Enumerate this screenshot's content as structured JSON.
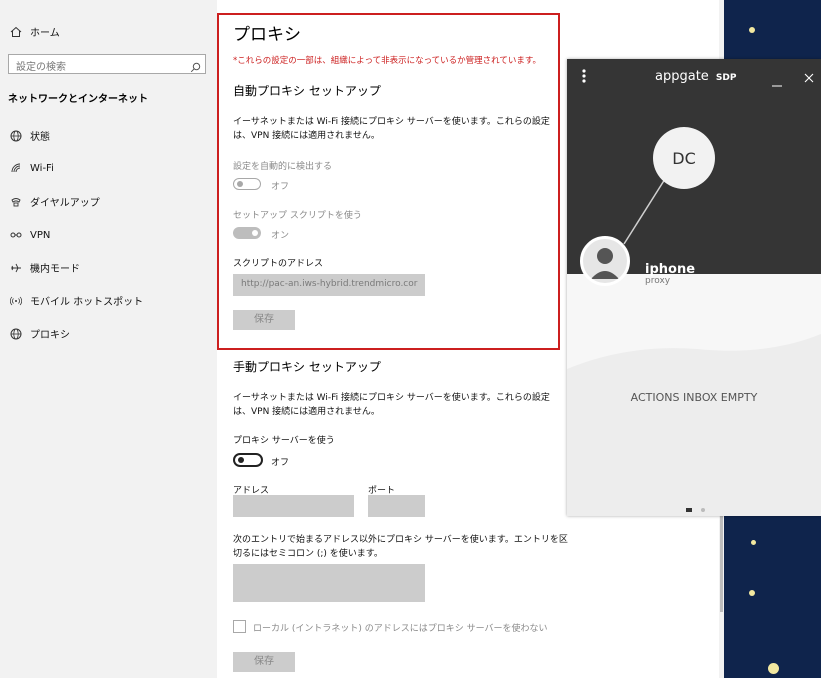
{
  "sidebar": {
    "home": "ホーム",
    "search_placeholder": "設定の検索",
    "section_heading": "ネットワークとインターネット",
    "items": [
      {
        "label": "状態",
        "icon": "globe-icon"
      },
      {
        "label": "Wi-Fi",
        "icon": "wifi-icon"
      },
      {
        "label": "ダイヤルアップ",
        "icon": "phone-icon"
      },
      {
        "label": "VPN",
        "icon": "vpn-icon"
      },
      {
        "label": "機内モード",
        "icon": "airplane-icon"
      },
      {
        "label": "モバイル ホットスポット",
        "icon": "hotspot-icon"
      },
      {
        "label": "プロキシ",
        "icon": "globe-icon"
      }
    ]
  },
  "proxy": {
    "title": "プロキシ",
    "warning": "*これらの設定の一部は、組織によって非表示になっているか管理されています。",
    "auto": {
      "heading": "自動プロキシ セットアップ",
      "description_line1": "イーサネットまたは Wi-Fi 接続にプロキシ サーバーを使います。これらの設定",
      "description_line2": "は、VPN 接続には適用されません。",
      "detect_label": "設定を自動的に検出する",
      "detect_state": "オフ",
      "script_label": "セットアップ スクリプトを使う",
      "script_state": "オン",
      "address_label": "スクリプトのアドレス",
      "address_value": "http://pac-an.iws-hybrid.trendmicro.cor",
      "save": "保存"
    },
    "manual": {
      "heading": "手動プロキシ セットアップ",
      "description_line1": "イーサネットまたは Wi-Fi 接続にプロキシ サーバーを使います。これらの設定",
      "description_line2": "は、VPN 接続には適用されません。",
      "use_proxy_label": "プロキシ サーバーを使う",
      "use_proxy_state": "オフ",
      "address_label": "アドレス",
      "port_label": "ポート",
      "exceptions_line1": "次のエントリで始まるアドレス以外にプロキシ サーバーを使います。エントリを区",
      "exceptions_line2": "切るにはセミコロン (;) を使います。",
      "local_checkbox": "ローカル (イントラネット) のアドレスにはプロキシ サーバーを使わない",
      "save": "保存"
    }
  },
  "appgate": {
    "logo_main": "appgate",
    "logo_suffix": "SDP",
    "node_label": "DC",
    "device_name": "iphone",
    "device_sub": "proxy",
    "inbox_status": "ACTIONS INBOX EMPTY"
  },
  "colors": {
    "warning_red": "#cc1f1f",
    "highlight_border": "#cc1f1f",
    "sidebar_bg": "#f2f2f2",
    "appgate_dark": "#353535",
    "night_bg": "#0f244c"
  }
}
